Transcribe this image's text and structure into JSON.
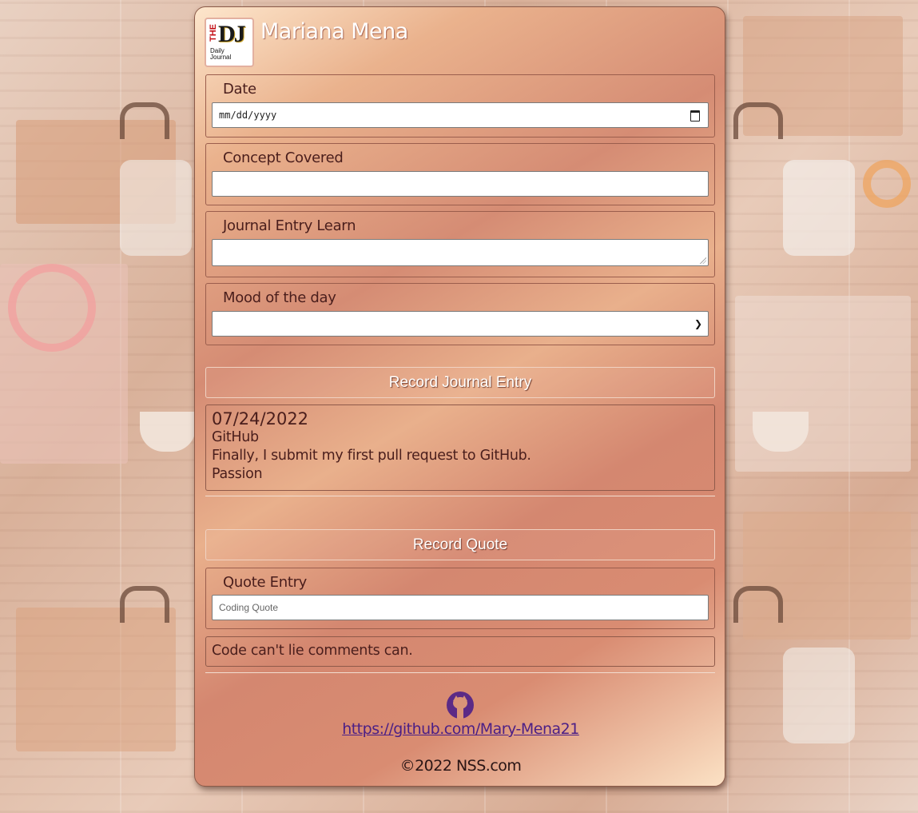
{
  "header": {
    "logo_the": "THE",
    "logo_dj": "DJ",
    "logo_daily": "Daily",
    "logo_journal": "Journal",
    "title": "Mariana Mena"
  },
  "form": {
    "date_label": "Date",
    "date_value": "mm/dd/yyyy",
    "concept_label": "Concept Covered",
    "concept_value": "",
    "journal_label": "Journal Entry Learn",
    "journal_value": "",
    "mood_label": "Mood of the day",
    "mood_value": "",
    "submit_label": "Record Journal Entry"
  },
  "entries": [
    {
      "date": "07/24/2022",
      "concept": "GitHub",
      "entry": "Finally, I submit my first pull request to GitHub.",
      "mood": "Passion"
    }
  ],
  "quote_form": {
    "button_label": "Record Quote",
    "quote_label": "Quote Entry",
    "quote_placeholder": "Coding Quote"
  },
  "quotes": [
    "Code can't lie comments can."
  ],
  "footer": {
    "icon": "github-icon",
    "link_text": "https://github.com/Mary-Mena21",
    "copyright": "©2022 NSS.com"
  },
  "colors": {
    "label_text": "#4a1e1c",
    "link": "#4b1f86",
    "github_icon": "#5b2a86"
  }
}
